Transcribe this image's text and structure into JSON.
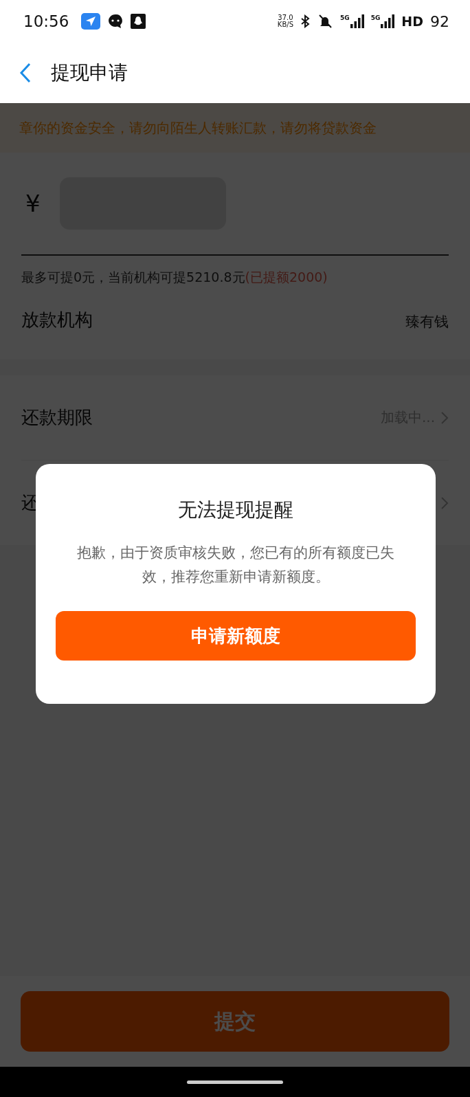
{
  "status_bar": {
    "time": "10:56",
    "speed_value": "37.0",
    "speed_unit": "KB/S",
    "network_labels": [
      "5G",
      "5G"
    ],
    "hd_label": "HD",
    "battery": "92"
  },
  "header": {
    "title": "提现申请"
  },
  "notice": {
    "text": "章你的资金安全，请勿向陌生人转账汇款，请勿将贷款资金"
  },
  "amount": {
    "currency": "¥",
    "hint": "最多可提0元，当前机构可提5210.8元",
    "hint_highlight": "(已提额2000)"
  },
  "lender_row": {
    "label": "放款机构",
    "value": "臻有钱"
  },
  "option_rows": [
    {
      "label": "还款期限",
      "value": "加载中..."
    },
    {
      "label": "还"
    }
  ],
  "submit_button": {
    "label": "提交",
    "disabled": false
  },
  "dialog": {
    "title": "无法提现提醒",
    "message": "抱歉，由于资质审核失败，您已有的所有额度已失效，推荐您重新申请新额度。",
    "button": "申请新额度"
  }
}
